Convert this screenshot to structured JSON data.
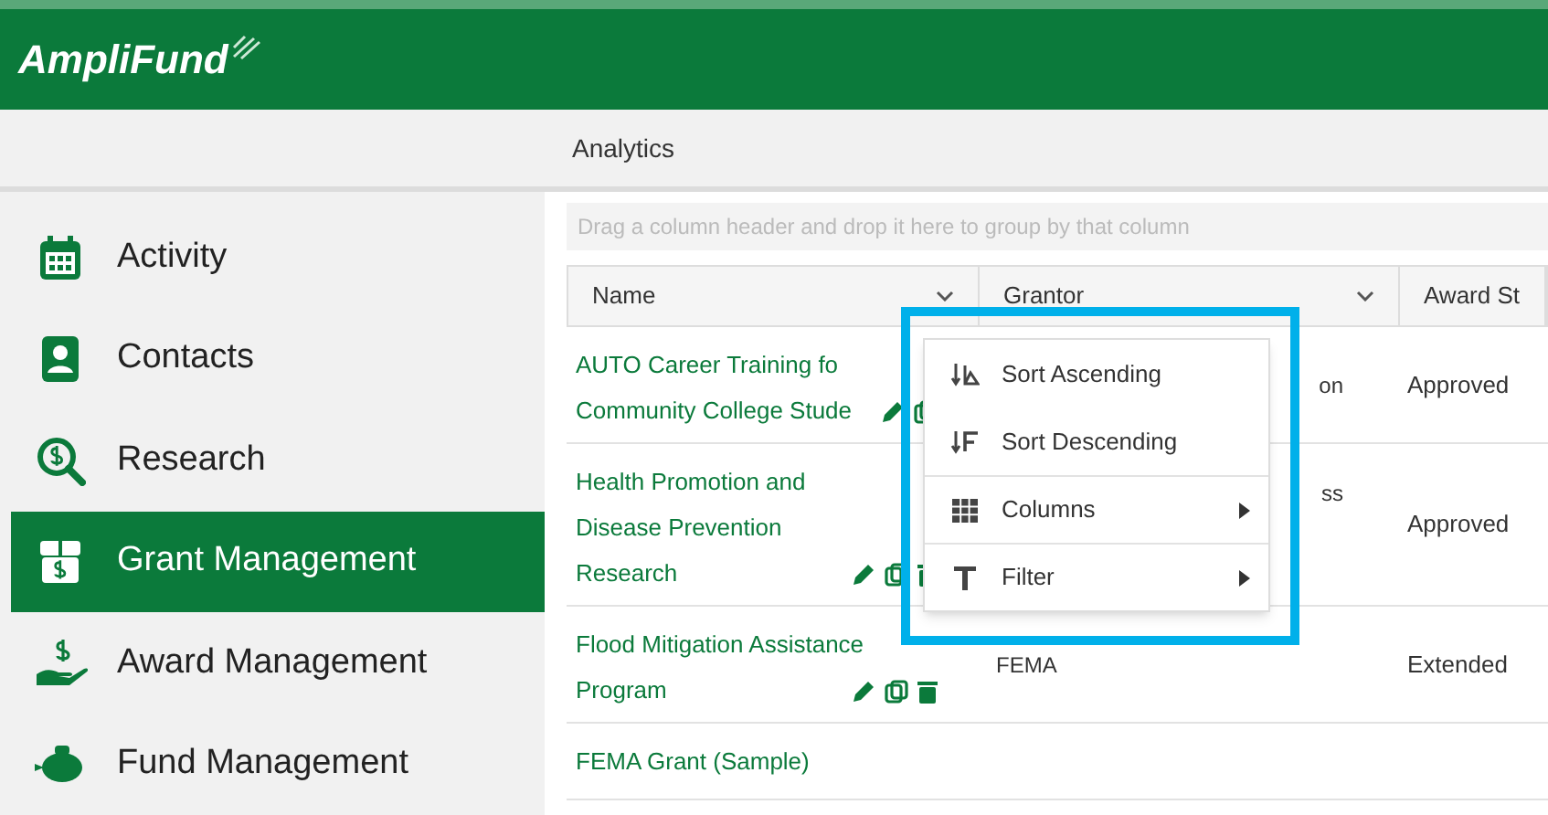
{
  "brand": "AmpliFund",
  "toolbar": {
    "title": "Analytics"
  },
  "sidebar": {
    "items": [
      {
        "label": "Activity",
        "kind": "calendar",
        "selected": false
      },
      {
        "label": "Contacts",
        "kind": "contacts",
        "selected": false
      },
      {
        "label": "Research",
        "kind": "research",
        "selected": false
      },
      {
        "label": "Grant Management",
        "kind": "grant",
        "selected": true
      },
      {
        "label": "Award Management",
        "kind": "award",
        "selected": false
      },
      {
        "label": "Fund Management",
        "kind": "fund",
        "selected": false
      }
    ]
  },
  "grid": {
    "group_hint": "Drag a column header and drop it here to group by that column",
    "columns": [
      "Name",
      "Grantor",
      "Award St"
    ],
    "rows": [
      {
        "name_lines": [
          "AUTO Career Training fo",
          "Community College Stude"
        ],
        "actions": [
          {
            "kind": "edit"
          },
          {
            "kind": "copy"
          }
        ],
        "grantor": "on",
        "award_status": "Approved"
      },
      {
        "name_lines": [
          "Health Promotion and",
          "Disease Prevention",
          "Research"
        ],
        "actions": [
          {
            "kind": "edit"
          },
          {
            "kind": "copy"
          },
          {
            "kind": "delete"
          }
        ],
        "grantor": "ss",
        "award_status": "Approved"
      },
      {
        "name_lines": [
          "Flood Mitigation Assistance",
          "Program"
        ],
        "actions": [
          {
            "kind": "edit"
          },
          {
            "kind": "copy"
          },
          {
            "kind": "delete"
          }
        ],
        "grantor": "FEMA",
        "award_status": "Extended"
      },
      {
        "name_lines": [
          "FEMA Grant (Sample)"
        ],
        "actions": [],
        "grantor": "",
        "award_status": ""
      }
    ]
  },
  "context_menu": {
    "items": [
      {
        "label": "Sort Ascending",
        "kind": "sort-asc",
        "submenu": false
      },
      {
        "label": "Sort Descending",
        "kind": "sort-desc",
        "submenu": false
      },
      {
        "label": "Columns",
        "kind": "columns",
        "submenu": true
      },
      {
        "label": "Filter",
        "kind": "filter",
        "submenu": true
      }
    ]
  }
}
